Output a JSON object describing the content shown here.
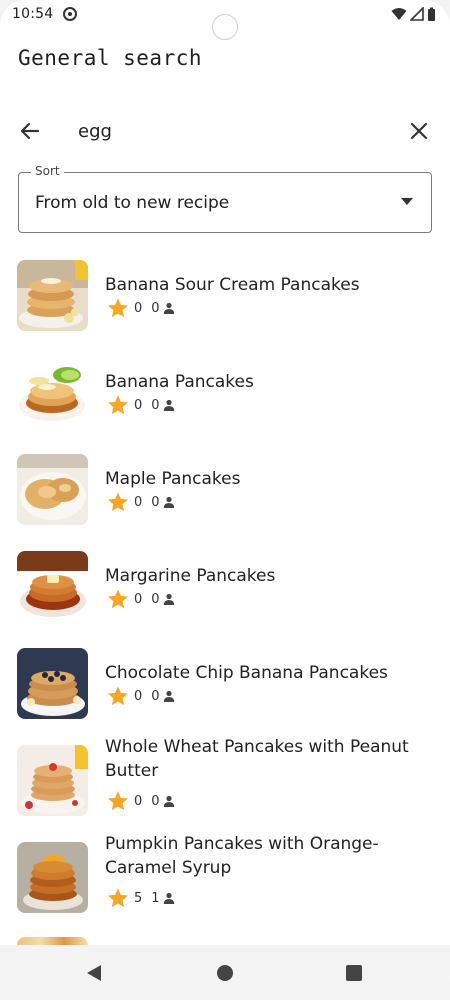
{
  "status_bar": {
    "time": "10:54"
  },
  "header": {
    "title": "General search"
  },
  "search": {
    "value": "egg",
    "placeholder": ""
  },
  "sort": {
    "label": "Sort",
    "selected": "From old to new recipe"
  },
  "recipes": [
    {
      "name": "Banana Sour Cream Pancakes",
      "rating": "0",
      "reviews": "0",
      "thumb": "banana-sour-cream-pancakes"
    },
    {
      "name": "Banana Pancakes",
      "rating": "0",
      "reviews": "0",
      "thumb": "banana-pancakes"
    },
    {
      "name": "Maple Pancakes",
      "rating": "0",
      "reviews": "0",
      "thumb": "maple-pancakes"
    },
    {
      "name": "Margarine Pancakes",
      "rating": "0",
      "reviews": "0",
      "thumb": "margarine-pancakes"
    },
    {
      "name": "Chocolate Chip Banana Pancakes",
      "rating": "0",
      "reviews": "0",
      "thumb": "chocolate-chip-banana-pancakes"
    },
    {
      "name": "Whole Wheat Pancakes with Peanut Butter",
      "rating": "0",
      "reviews": "0",
      "thumb": "whole-wheat-pancakes"
    },
    {
      "name": "Pumpkin Pancakes with Orange-Caramel Syrup",
      "rating": "5",
      "reviews": "1",
      "thumb": "pumpkin-pancakes"
    }
  ],
  "colors": {
    "star": "#f5a623",
    "text": "#222222",
    "outline": "#7a7a7a"
  },
  "icons": {
    "back": "arrow-left-icon",
    "clear": "close-icon",
    "dropdown": "caret-down-icon",
    "rating": "star-icon",
    "reviews": "person-icon"
  }
}
